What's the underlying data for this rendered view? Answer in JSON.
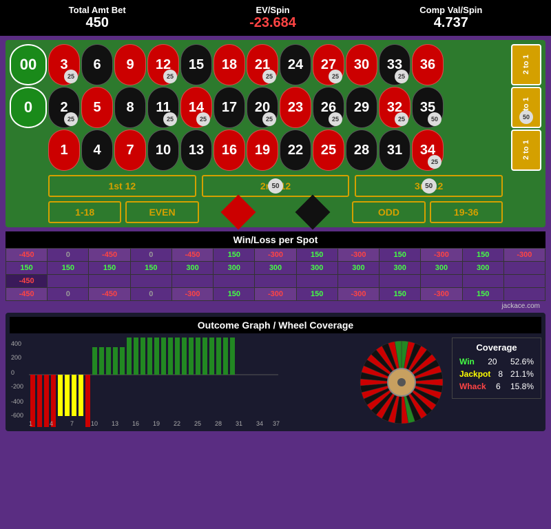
{
  "header": {
    "total_amt_label": "Total Amt Bet",
    "total_amt_value": "450",
    "ev_spin_label": "EV/Spin",
    "ev_spin_value": "-23.684",
    "comp_val_label": "Comp Val/Spin",
    "comp_val_value": "4.737"
  },
  "table": {
    "zeros": [
      {
        "label": "00",
        "chip": null
      },
      {
        "label": "0",
        "chip": null
      }
    ],
    "columns": [
      [
        {
          "num": "3",
          "color": "red",
          "chip": "25"
        },
        {
          "num": "2",
          "color": "black",
          "chip": "25"
        },
        {
          "num": "1",
          "color": "red",
          "chip": null
        }
      ],
      [
        {
          "num": "6",
          "color": "black",
          "chip": null
        },
        {
          "num": "5",
          "color": "red",
          "chip": null
        },
        {
          "num": "4",
          "color": "black",
          "chip": null
        }
      ],
      [
        {
          "num": "9",
          "color": "red",
          "chip": null
        },
        {
          "num": "8",
          "color": "black",
          "chip": null
        },
        {
          "num": "7",
          "color": "red",
          "chip": null
        }
      ],
      [
        {
          "num": "12",
          "color": "red",
          "chip": "25"
        },
        {
          "num": "11",
          "color": "black",
          "chip": "25"
        },
        {
          "num": "10",
          "color": "black",
          "chip": null
        }
      ],
      [
        {
          "num": "15",
          "color": "black",
          "chip": null
        },
        {
          "num": "14",
          "color": "red",
          "chip": "25"
        },
        {
          "num": "13",
          "color": "black",
          "chip": null
        }
      ],
      [
        {
          "num": "18",
          "color": "red",
          "chip": null
        },
        {
          "num": "17",
          "color": "black",
          "chip": null
        },
        {
          "num": "16",
          "color": "red",
          "chip": null
        }
      ],
      [
        {
          "num": "21",
          "color": "red",
          "chip": "25"
        },
        {
          "num": "20",
          "color": "black",
          "chip": "25"
        },
        {
          "num": "19",
          "color": "red",
          "chip": null
        }
      ],
      [
        {
          "num": "24",
          "color": "black",
          "chip": null
        },
        {
          "num": "23",
          "color": "red",
          "chip": null
        },
        {
          "num": "22",
          "color": "black",
          "chip": null
        }
      ],
      [
        {
          "num": "27",
          "color": "red",
          "chip": "25"
        },
        {
          "num": "26",
          "color": "black",
          "chip": "25"
        },
        {
          "num": "25",
          "color": "red",
          "chip": null
        }
      ],
      [
        {
          "num": "30",
          "color": "red",
          "chip": null
        },
        {
          "num": "29",
          "color": "black",
          "chip": null
        },
        {
          "num": "28",
          "color": "black",
          "chip": null
        }
      ],
      [
        {
          "num": "33",
          "color": "black",
          "chip": "25"
        },
        {
          "num": "32",
          "color": "red",
          "chip": "25"
        },
        {
          "num": "31",
          "color": "black",
          "chip": null
        }
      ],
      [
        {
          "num": "36",
          "color": "red",
          "chip": null
        },
        {
          "num": "35",
          "color": "black",
          "chip": "50"
        },
        {
          "num": "34",
          "color": "red",
          "chip": "25"
        }
      ]
    ],
    "col_bets": [
      {
        "label": "2 to 1",
        "chip": null
      },
      {
        "label": "2 to 1",
        "chip": "50"
      },
      {
        "label": "2 to 1",
        "chip": null
      }
    ],
    "dozens": [
      {
        "label": "1st 12",
        "chip": null
      },
      {
        "label": "2nd 12",
        "chip": "50"
      },
      {
        "label": "3rd 12",
        "chip": "50"
      }
    ],
    "even_money": [
      {
        "label": "1-18"
      },
      {
        "label": "EVEN"
      },
      {
        "label": "RED_DIAMOND"
      },
      {
        "label": "BLACK_DIAMOND"
      },
      {
        "label": "ODD"
      },
      {
        "label": "19-36"
      }
    ]
  },
  "winloss": {
    "title": "Win/Loss per Spot",
    "rows": [
      [
        "-450",
        "0",
        "-450",
        "0",
        "-450",
        "150",
        "-300",
        "150",
        "-300",
        "150",
        "-300",
        "150",
        "-300"
      ],
      [
        "150",
        "150",
        "150",
        "150",
        "300",
        "300",
        "300",
        "300",
        "300",
        "300",
        "300",
        "300",
        ""
      ],
      [
        "-450",
        "",
        "",
        "",
        "",
        "",
        "",
        "",
        "",
        "",
        "",
        "",
        ""
      ],
      [
        "-450",
        "0",
        "-450",
        "0",
        "-300",
        "150",
        "-300",
        "150",
        "-300",
        "150",
        "-300",
        "150",
        ""
      ]
    ]
  },
  "graph": {
    "title": "Outcome Graph / Wheel Coverage",
    "y_labels": [
      "400",
      "200",
      "0",
      "-200",
      "-400",
      "-600"
    ],
    "x_labels": [
      "1",
      "4",
      "7",
      "10",
      "13",
      "16",
      "19",
      "22",
      "25",
      "28",
      "31",
      "34",
      "37"
    ],
    "bars": [
      {
        "value": -5,
        "color": "#cc0000"
      },
      {
        "value": -5,
        "color": "#cc0000"
      },
      {
        "value": -5,
        "color": "#cc0000"
      },
      {
        "value": -5,
        "color": "#cc0000"
      },
      {
        "value": -3,
        "color": "#ffff00"
      },
      {
        "value": -3,
        "color": "#ffff00"
      },
      {
        "value": -3,
        "color": "#ffff00"
      },
      {
        "value": -3,
        "color": "#ffff00"
      },
      {
        "value": -5,
        "color": "#cc0000"
      },
      {
        "value": 2,
        "color": "#44aa44"
      },
      {
        "value": 2,
        "color": "#44aa44"
      },
      {
        "value": 2,
        "color": "#44aa44"
      },
      {
        "value": 2,
        "color": "#44aa44"
      },
      {
        "value": 2,
        "color": "#44aa44"
      },
      {
        "value": 3,
        "color": "#44aa44"
      },
      {
        "value": 3,
        "color": "#44aa44"
      },
      {
        "value": 3,
        "color": "#44aa44"
      },
      {
        "value": 3,
        "color": "#44aa44"
      },
      {
        "value": 3,
        "color": "#44aa44"
      },
      {
        "value": 4,
        "color": "#44aa44"
      },
      {
        "value": 4,
        "color": "#44aa44"
      },
      {
        "value": 4,
        "color": "#44aa44"
      },
      {
        "value": 4,
        "color": "#44aa44"
      },
      {
        "value": 4,
        "color": "#44aa44"
      },
      {
        "value": 4,
        "color": "#44aa44"
      },
      {
        "value": 4,
        "color": "#44aa44"
      },
      {
        "value": 4,
        "color": "#44aa44"
      },
      {
        "value": 4,
        "color": "#44aa44"
      },
      {
        "value": 4,
        "color": "#44aa44"
      },
      {
        "value": 4,
        "color": "#44aa44"
      }
    ]
  },
  "coverage": {
    "title": "Coverage",
    "win_label": "Win",
    "win_count": "20",
    "win_pct": "52.6%",
    "jackpot_label": "Jackpot",
    "jackpot_count": "8",
    "jackpot_pct": "21.1%",
    "whack_label": "Whack",
    "whack_count": "6",
    "whack_pct": "15.8%"
  },
  "credit": "jackace.com"
}
